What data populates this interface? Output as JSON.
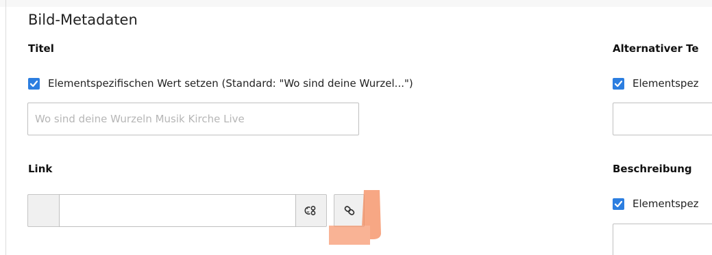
{
  "section": {
    "title": "Bild-Metadaten"
  },
  "left": {
    "title_label": "Titel",
    "title_override_label": "Elementspezifischen Wert setzen (Standard: \"Wo sind deine Wurzel...\")",
    "title_input_value": "",
    "title_input_placeholder": "Wo sind deine Wurzeln Musik Kirche Live",
    "link_label": "Link",
    "link_input_value": ""
  },
  "right": {
    "alt_label": "Alternativer Te",
    "alt_override_label": "Elementspez",
    "description_label": "Beschreibung",
    "description_override_label": "Elementspez"
  },
  "icons": {
    "checkbox": "checkmark-icon",
    "browse": "browse-page-icon",
    "link": "chain-link-icon"
  },
  "colors": {
    "checkbox": "#2c7ee0",
    "annotation": "#f7936a"
  }
}
